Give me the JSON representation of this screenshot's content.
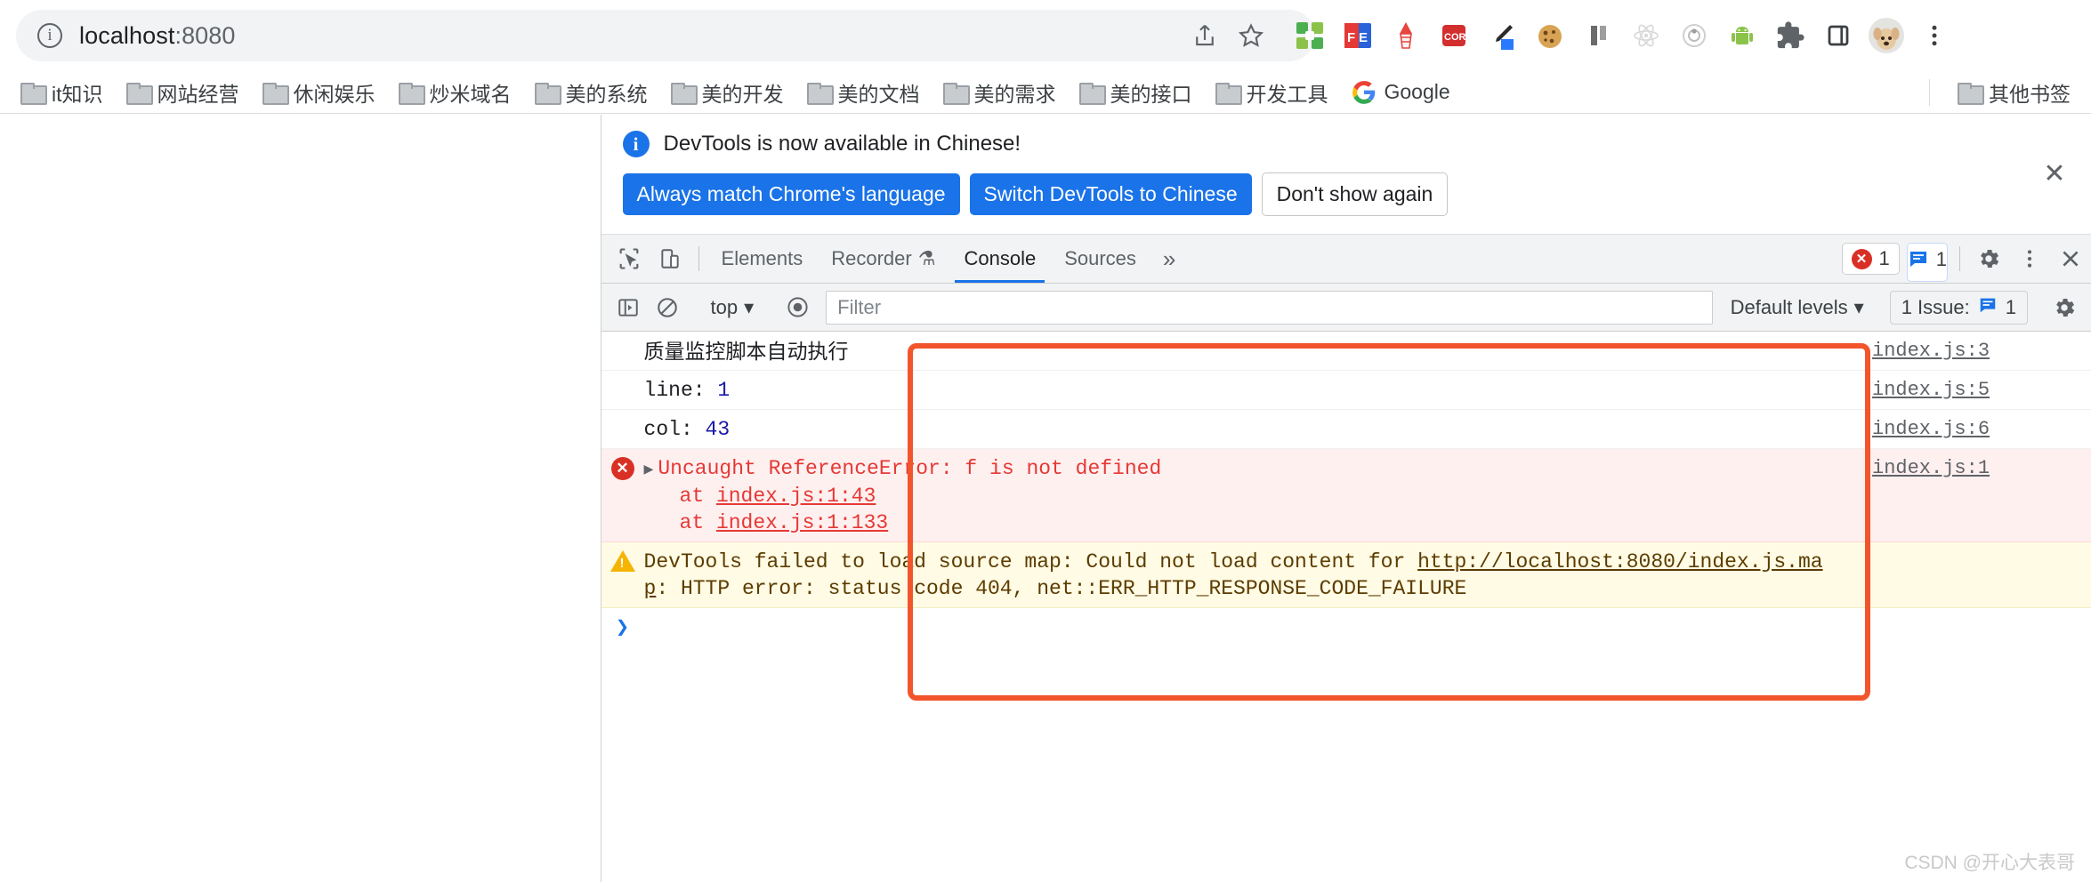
{
  "browser": {
    "url_host": "localhost",
    "url_port": ":8080",
    "info_icon": "info-circle-icon",
    "share_icon": "share-icon",
    "bookmark_icon": "star-icon",
    "menu_icon": "three-dot-menu-icon",
    "extensions": [
      {
        "name": "quadrant-grid-extension-icon",
        "glyph": "▦"
      },
      {
        "name": "fehelper-extension-icon",
        "glyph": "FE"
      },
      {
        "name": "lighthouse-extension-icon",
        "glyph": "▲"
      },
      {
        "name": "cors-unblock-extension-icon",
        "glyph": "CORS"
      },
      {
        "name": "colorpick-eyedropper-extension-icon",
        "glyph": "⟋"
      },
      {
        "name": "cookie-editor-extension-icon",
        "glyph": "●"
      },
      {
        "name": "vue-devtools-extension-icon",
        "glyph": "▮▯"
      },
      {
        "name": "react-devtools-extension-icon",
        "glyph": "⚛"
      },
      {
        "name": "axure-extension-icon",
        "glyph": "◎"
      },
      {
        "name": "android-extension-icon",
        "glyph": "🤖"
      },
      {
        "name": "extensions-puzzle-icon",
        "glyph": "🧩"
      },
      {
        "name": "side-panel-icon",
        "glyph": "▯"
      },
      {
        "name": "profile-avatar-icon",
        "glyph": "🐶"
      }
    ]
  },
  "bookmarks": {
    "items": [
      {
        "label": "it知识"
      },
      {
        "label": "网站经营"
      },
      {
        "label": "休闲娱乐"
      },
      {
        "label": "炒米域名"
      },
      {
        "label": "美的系统"
      },
      {
        "label": "美的开发"
      },
      {
        "label": "美的文档"
      },
      {
        "label": "美的需求"
      },
      {
        "label": "美的接口"
      },
      {
        "label": "开发工具"
      },
      {
        "label": "Google"
      }
    ],
    "other": "其他书签"
  },
  "devtools": {
    "notice": {
      "message": "DevTools is now available in Chinese!",
      "btn_always": "Always match Chrome's language",
      "btn_switch": "Switch DevTools to Chinese",
      "btn_dont_show": "Don't show again",
      "close": "✕"
    },
    "tabbar": {
      "inspect_icon": "inspect-element-icon",
      "device_icon": "device-toolbar-icon",
      "tabs": [
        {
          "label": "Elements",
          "active": false
        },
        {
          "label": "Recorder",
          "active": false,
          "suffix": "⚗"
        },
        {
          "label": "Console",
          "active": true
        },
        {
          "label": "Sources",
          "active": false
        }
      ],
      "more": "»",
      "error_count": "1",
      "message_count": "1",
      "settings_icon": "gear-icon",
      "kebab_icon": "three-dot-menu-icon",
      "close_icon": "close-icon"
    },
    "consolebar": {
      "sidebar_icon": "console-sidebar-icon",
      "clear_icon": "clear-console-icon",
      "context": "top",
      "eye_icon": "live-expression-icon",
      "filter_placeholder": "Filter",
      "filter_value": "",
      "levels": "Default levels",
      "issues_label": "1 Issue:",
      "issues_count": "1",
      "settings_icon": "gear-icon"
    },
    "messages": [
      {
        "type": "log",
        "text": "质量监控脚本自动执行",
        "source": "index.js:3"
      },
      {
        "type": "log-kv",
        "key": "line: ",
        "value": "1",
        "source": "index.js:5"
      },
      {
        "type": "log-kv",
        "key": "col: ",
        "value": "43",
        "source": "index.js:6"
      },
      {
        "type": "error",
        "text": "Uncaught ReferenceError: f is not defined",
        "stack": [
          "at index.js:1:43",
          "at index.js:1:133"
        ],
        "stack_at": "at ",
        "stack_links": [
          "index.js:1:43",
          "index.js:1:133"
        ],
        "source": "index.js:1"
      },
      {
        "type": "warning",
        "text_pre": "DevTools failed to load source map: Could not load content for ",
        "link": "http://localhost:8080/index.js.map",
        "text_post": ": HTTP error: status code 404, net::ERR_HTTP_RESPONSE_CODE_FAILURE",
        "source": ""
      }
    ],
    "prompt_caret": "❯"
  },
  "watermark": "CSDN @开心大表哥",
  "colors": {
    "accent_blue": "#1a73e8",
    "error_red": "#d93025",
    "warn_yellow": "#f5b400",
    "annotation_orange": "#f2552c"
  }
}
